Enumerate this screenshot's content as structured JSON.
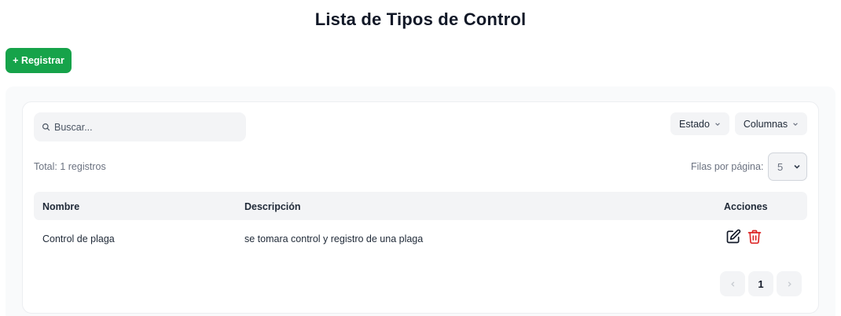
{
  "page": {
    "title": "Lista de Tipos de Control"
  },
  "toolbar": {
    "register_label": "+ Registrar"
  },
  "search": {
    "placeholder": "Buscar..."
  },
  "filters": {
    "estado_label": "Estado",
    "columnas_label": "Columnas"
  },
  "summary": {
    "total_text": "Total: 1 registros"
  },
  "pagination": {
    "rows_label": "Filas por página:",
    "rows_value": "5",
    "current_page": "1"
  },
  "table": {
    "headers": {
      "nombre": "Nombre",
      "descripcion": "Descripción",
      "acciones": "Acciones"
    },
    "rows": [
      {
        "nombre": "Control de plaga",
        "descripcion": "se tomara control y registro de una plaga"
      }
    ]
  },
  "colors": {
    "primary": "#16a34a",
    "danger": "#dc2626",
    "surface": "#f3f4f6"
  },
  "icons": [
    "search-icon",
    "chevron-down-icon",
    "edit-icon",
    "trash-icon",
    "chevron-left-icon",
    "chevron-right-icon"
  ]
}
